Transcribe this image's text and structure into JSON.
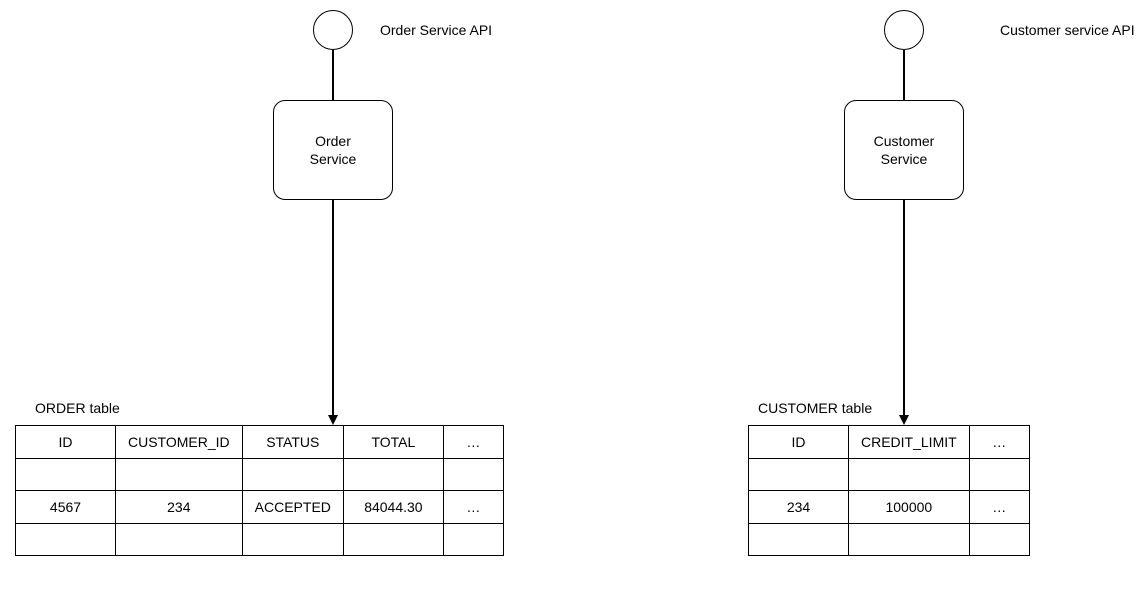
{
  "order_side": {
    "api_label": "Order Service API",
    "service_name_line1": "Order",
    "service_name_line2": "Service",
    "table_label": "ORDER table",
    "columns": {
      "c1": "ID",
      "c2": "CUSTOMER_ID",
      "c3": "STATUS",
      "c4": "TOTAL",
      "c5": "…"
    },
    "row": {
      "c1": "4567",
      "c2": "234",
      "c3": "ACCEPTED",
      "c4": "84044.30",
      "c5": "…"
    }
  },
  "customer_side": {
    "api_label": "Customer service API",
    "service_name_line1": "Customer",
    "service_name_line2": "Service",
    "table_label": "CUSTOMER table",
    "columns": {
      "c1": "ID",
      "c2": "CREDIT_LIMIT",
      "c3": "…"
    },
    "row": {
      "c1": "234",
      "c2": "100000",
      "c3": "…"
    }
  }
}
